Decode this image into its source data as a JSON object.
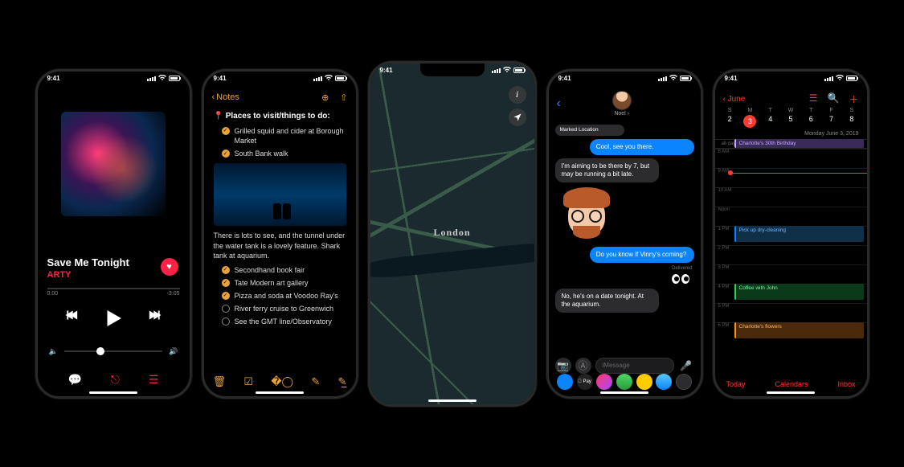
{
  "status": {
    "time": "9:41"
  },
  "music": {
    "title": "Save Me Tonight",
    "artist": "ARTY",
    "elapsed": "0:00",
    "remaining": "-3:05"
  },
  "notes": {
    "back": "Notes",
    "heading": "📍 Places to visit/things to do:",
    "items_a": [
      "Grilled squid and cider at Borough Market",
      "South Bank walk"
    ],
    "paragraph": "There is lots to see, and the tunnel under the water tank is a lovely feature. Shark tank at aquarium.",
    "items_b": [
      "Secondhand book fair",
      "Tate Modern art gallery",
      "Pizza and soda at Voodoo Ray's"
    ],
    "items_c": [
      "River ferry cruise to Greenwich",
      "See the GMT line/Observatory"
    ]
  },
  "maps": {
    "city": "London"
  },
  "messages": {
    "contact": "Noel",
    "pin_label": "Marked Location",
    "out1": "Cool, see you there.",
    "in1": "I'm aiming to be there by 7, but may be running a bit late.",
    "out2": "Do you know if Vinny's coming?",
    "delivered": "Delivered",
    "in2": "No, he's on a date tonight. At the aquarium.",
    "placeholder": "iMessage",
    "apple_pay": " Pay"
  },
  "calendar": {
    "month": "June",
    "days": [
      "S",
      "M",
      "T",
      "W",
      "T",
      "F",
      "S"
    ],
    "dates": [
      "2",
      "3",
      "4",
      "5",
      "6",
      "7",
      "8"
    ],
    "today_index": 1,
    "date_string": "Monday  June 3, 2019",
    "allday_label": "all-day",
    "allday_event": "Charlotte's 30th Birthday",
    "hours": [
      "8 AM",
      "9 AM",
      "10 AM",
      "Noon",
      "1 PM",
      "2 PM",
      "3 PM",
      "4 PM",
      "5 PM",
      "6 PM"
    ],
    "ev1": "Pick up dry-cleaning",
    "ev2": "Coffee with John",
    "ev3": "Charlotte's flowers",
    "bottom": {
      "today": "Today",
      "calendars": "Calendars",
      "inbox": "Inbox"
    }
  }
}
